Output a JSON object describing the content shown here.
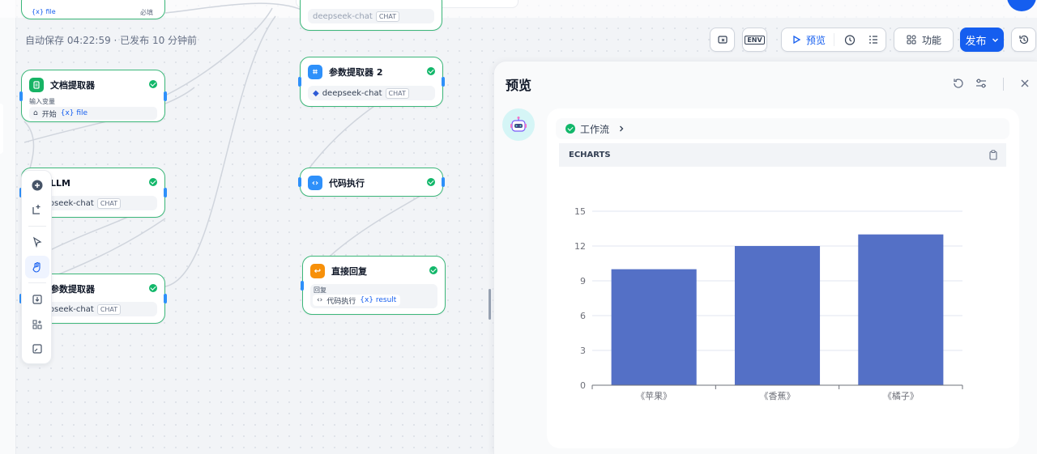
{
  "canvas": {
    "autosave_text": "自动保存 04:22:59 · 已发布 10 分钟前",
    "top_partial_file": "{x} file",
    "top_partial_required": "必填",
    "top_partial_model": "deepseek-chat",
    "top_partial_chat": "CHAT"
  },
  "nodes": {
    "doc_extractor": {
      "title": "文档提取器",
      "input_label": "输入变量",
      "source": "开始",
      "var": "{x} file",
      "icon_color": "#16b364"
    },
    "llm": {
      "title": "LLM",
      "model": "deepseek-chat",
      "tag": "CHAT",
      "icon_color": "#6172f3"
    },
    "param_extractor": {
      "title": "参数提取器",
      "model": "deepseek-chat",
      "tag": "CHAT",
      "icon_color": "#2e90fa"
    },
    "param_extractor_2": {
      "title": "参数提取器 2",
      "model": "deepseek-chat",
      "tag": "CHAT",
      "icon_color": "#2e90fa"
    },
    "code_exec": {
      "title": "代码执行",
      "icon_color": "#2e90fa"
    },
    "direct_reply": {
      "title": "直接回复",
      "reply_label": "回复",
      "source": "代码执行",
      "var": "{x} result",
      "icon_color": "#f79009"
    }
  },
  "toolbar": {
    "preview_label": "预览",
    "env_label": "ENV",
    "features_label": "功能",
    "publish_label": "发布"
  },
  "panel": {
    "title": "预览",
    "workflow_label": "工作流",
    "echarts_label": "ECHARTS"
  },
  "colors": {
    "accent": "#155eef",
    "node_border": "#3cb77a",
    "bar": "#5470c6"
  },
  "chart_data": {
    "type": "bar",
    "categories": [
      "《苹果》",
      "《香蕉》",
      "《橘子》"
    ],
    "values": [
      10,
      12,
      13
    ],
    "title": "",
    "xlabel": "",
    "ylabel": "",
    "ylim": [
      0,
      15
    ],
    "yticks": [
      0,
      3,
      6,
      9,
      12,
      15
    ],
    "grid": true,
    "color": "#5470c6"
  }
}
